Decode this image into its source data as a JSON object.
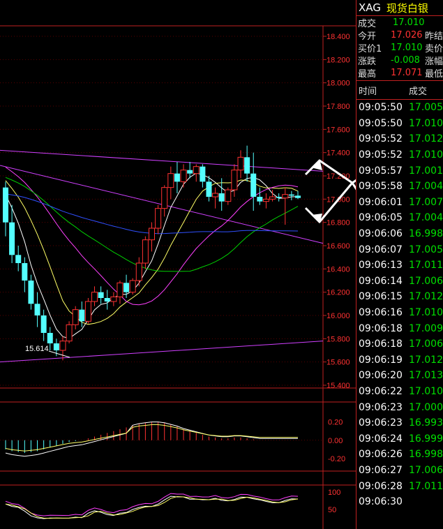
{
  "colors": {
    "border": "#c02020",
    "up_candle": "#ff3232",
    "down_candle": "#54ffff",
    "price_green": "#00e000",
    "price_red": "#ff3232",
    "title_yellow": "#ffff00",
    "ma_white": "#ffffff",
    "ma_yellow": "#ffff66",
    "ma_magenta": "#ff40ff",
    "ma_green": "#00d000",
    "ma_blue": "#3050ff",
    "trend_violet": "#d040ff"
  },
  "header": {
    "symbol": "XAG",
    "name": "现货白银"
  },
  "quotes": [
    {
      "label": "成交",
      "value": "17.010",
      "color": "green",
      "label2": ""
    },
    {
      "label": "今开",
      "value": "17.026",
      "color": "red",
      "label2": "昨结"
    },
    {
      "label": "买价1",
      "value": "17.010",
      "color": "green",
      "label2": "卖价"
    },
    {
      "label": "涨跌",
      "value": "-0.008",
      "color": "green",
      "label2": "涨幅"
    },
    {
      "label": "最高",
      "value": "17.071",
      "color": "red",
      "label2": "最低"
    }
  ],
  "trades_header": {
    "time": "时间",
    "price": "成交"
  },
  "trades": [
    {
      "time": "09:05:50",
      "price": "17.005",
      "color": "green"
    },
    {
      "time": "09:05:50",
      "price": "17.010",
      "color": "green"
    },
    {
      "time": "09:05:52",
      "price": "17.012",
      "color": "green"
    },
    {
      "time": "09:05:52",
      "price": "17.010",
      "color": "green"
    },
    {
      "time": "09:05:57",
      "price": "17.001",
      "color": "green"
    },
    {
      "time": "09:05:58",
      "price": "17.004",
      "color": "green"
    },
    {
      "time": "09:06:01",
      "price": "17.007",
      "color": "green"
    },
    {
      "time": "09:06:05",
      "price": "17.004",
      "color": "green"
    },
    {
      "time": "09:06:06",
      "price": "16.998",
      "color": "green"
    },
    {
      "time": "09:06:07",
      "price": "17.005",
      "color": "green"
    },
    {
      "time": "09:06:13",
      "price": "17.011",
      "color": "green"
    },
    {
      "time": "09:06:14",
      "price": "17.006",
      "color": "green"
    },
    {
      "time": "09:06:15",
      "price": "17.012",
      "color": "green"
    },
    {
      "time": "09:06:16",
      "price": "17.010",
      "color": "green"
    },
    {
      "time": "09:06:18",
      "price": "17.009",
      "color": "green"
    },
    {
      "time": "09:06:18",
      "price": "17.006",
      "color": "green"
    },
    {
      "time": "09:06:19",
      "price": "17.012",
      "color": "green"
    },
    {
      "time": "09:06:20",
      "price": "17.013",
      "color": "green"
    },
    {
      "time": "09:06:22",
      "price": "17.010",
      "color": "green"
    },
    {
      "time": "09:06:23",
      "price": "17.000",
      "color": "green"
    },
    {
      "time": "09:06:23",
      "price": "16.993",
      "color": "green"
    },
    {
      "time": "09:06:24",
      "price": "16.999",
      "color": "green"
    },
    {
      "time": "09:06:26",
      "price": "16.998",
      "color": "green"
    },
    {
      "time": "09:06:27",
      "price": "17.006",
      "color": "green"
    },
    {
      "time": "09:06:28",
      "price": "17.011",
      "color": "green"
    },
    {
      "time": "09:06:30",
      "price": "",
      "color": "green"
    }
  ],
  "price_axis": [
    "18.400",
    "18.200",
    "18.000",
    "17.800",
    "17.600",
    "17.400",
    "17.200",
    "17.000",
    "16.800",
    "16.600",
    "16.400",
    "16.200",
    "16.000",
    "15.800",
    "15.600",
    "15.400"
  ],
  "price_range": [
    15.4,
    18.4
  ],
  "low_annotation": "15.614",
  "macd_axis": [
    "0.20",
    "0.00",
    "-0.20"
  ],
  "kdj_axis": [
    "100",
    "50"
  ],
  "candles": [
    [
      17.1,
      17.15,
      16.68,
      16.8
    ],
    [
      16.8,
      16.95,
      16.45,
      16.52
    ],
    [
      16.52,
      16.6,
      16.38,
      16.45
    ],
    [
      16.45,
      16.5,
      16.2,
      16.3
    ],
    [
      16.3,
      16.35,
      16.05,
      16.1
    ],
    [
      16.1,
      16.2,
      15.9,
      16.0
    ],
    [
      16.0,
      16.05,
      15.78,
      15.85
    ],
    [
      15.85,
      15.9,
      15.7,
      15.76
    ],
    [
      15.76,
      15.8,
      15.65,
      15.7
    ],
    [
      15.7,
      15.82,
      15.614,
      15.78
    ],
    [
      15.78,
      15.95,
      15.76,
      15.92
    ],
    [
      15.92,
      16.08,
      15.88,
      16.05
    ],
    [
      16.05,
      16.12,
      15.9,
      15.95
    ],
    [
      15.95,
      16.15,
      15.93,
      16.12
    ],
    [
      16.12,
      16.25,
      16.08,
      16.2
    ],
    [
      16.2,
      16.25,
      16.1,
      16.15
    ],
    [
      16.15,
      16.22,
      16.05,
      16.12
    ],
    [
      16.12,
      16.2,
      16.08,
      16.16
    ],
    [
      16.16,
      16.3,
      16.1,
      16.28
    ],
    [
      16.28,
      16.35,
      16.15,
      16.2
    ],
    [
      16.2,
      16.32,
      16.18,
      16.3
    ],
    [
      16.3,
      16.5,
      16.25,
      16.45
    ],
    [
      16.45,
      16.68,
      16.4,
      16.65
    ],
    [
      16.65,
      16.8,
      16.55,
      16.75
    ],
    [
      16.75,
      16.95,
      16.7,
      16.92
    ],
    [
      16.92,
      17.12,
      16.85,
      17.1
    ],
    [
      17.1,
      17.28,
      17.0,
      17.22
    ],
    [
      17.22,
      17.32,
      17.05,
      17.15
    ],
    [
      17.15,
      17.3,
      17.1,
      17.25
    ],
    [
      17.25,
      17.32,
      17.18,
      17.22
    ],
    [
      17.22,
      17.3,
      17.15,
      17.28
    ],
    [
      17.28,
      17.3,
      17.1,
      17.15
    ],
    [
      17.15,
      17.2,
      16.98,
      17.02
    ],
    [
      17.02,
      17.1,
      16.92,
      17.05
    ],
    [
      17.05,
      17.18,
      16.9,
      16.98
    ],
    [
      16.98,
      17.1,
      16.95,
      17.08
    ],
    [
      17.08,
      17.3,
      17.02,
      17.25
    ],
    [
      17.25,
      17.42,
      17.18,
      17.36
    ],
    [
      17.36,
      17.46,
      17.15,
      17.22
    ],
    [
      17.22,
      17.4,
      16.9,
      17.02
    ],
    [
      17.02,
      17.1,
      16.95,
      16.98
    ],
    [
      16.98,
      17.05,
      16.92,
      17.0
    ],
    [
      17.0,
      17.08,
      16.98,
      17.02
    ],
    [
      17.02,
      17.05,
      16.98,
      17.01
    ],
    [
      17.01,
      17.1,
      16.78,
      17.04
    ],
    [
      17.04,
      17.07,
      16.99,
      17.03
    ],
    [
      17.03,
      17.07,
      17.0,
      17.01
    ]
  ],
  "macd_bars": [
    -0.1,
    -0.12,
    -0.13,
    -0.14,
    -0.13,
    -0.12,
    -0.1,
    -0.08,
    -0.06,
    -0.04,
    -0.02,
    -0.01,
    0.0,
    0.02,
    0.04,
    0.06,
    0.08,
    0.1,
    0.12,
    0.14,
    0.16,
    0.18,
    0.19,
    0.2,
    0.2,
    0.19,
    0.17,
    0.15,
    0.12,
    0.1,
    0.08,
    0.06,
    0.04,
    0.03,
    0.02,
    0.02,
    0.03,
    0.03,
    0.02,
    0.01,
    0.0,
    0.0,
    0.0,
    0.0,
    0.0,
    0.0,
    0.0
  ]
}
